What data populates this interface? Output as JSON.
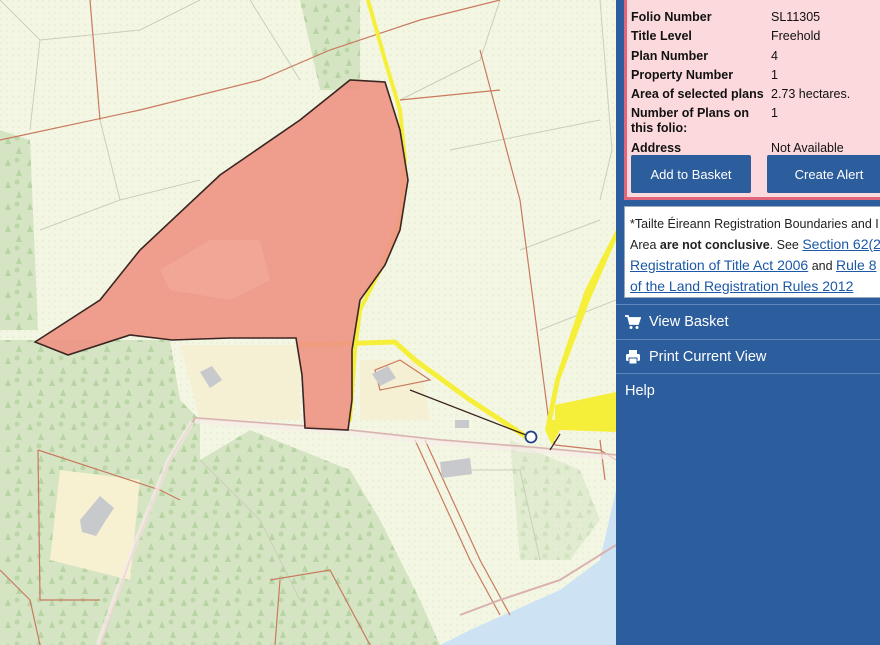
{
  "folio": {
    "rows": [
      {
        "label": "Folio Number",
        "value": "SL11305"
      },
      {
        "label": "Title Level",
        "value": "Freehold"
      },
      {
        "label": "Plan Number",
        "value": "4"
      },
      {
        "label": "Property Number",
        "value": "1"
      },
      {
        "label": "Area of selected plans",
        "value": "2.73 hectares."
      },
      {
        "label": "Number of Plans on this folio:",
        "value": "1"
      },
      {
        "label": "Address",
        "value": "Not Available"
      }
    ],
    "add_to_basket_label": "Add to Basket",
    "create_alert_label": "Create Alert"
  },
  "notice": {
    "line1": "*Tailte Éireann Registration Boundaries and I",
    "line2_pre": "Area ",
    "line2_bold": "are not conclusive",
    "line2_post": ". See ",
    "link1_a": "Section 62(2",
    "link1_b": "Registration of Title Act 2006",
    "and_text": " and ",
    "link2_a": "Rule 8",
    "link2_b": "of the Land Registration Rules 2012"
  },
  "menu": {
    "view_basket": "View Basket",
    "print_current_view": "Print Current View",
    "help": "Help"
  },
  "colors": {
    "panel_bg": "#2c5d9c",
    "folio_bg": "#fbd9dc",
    "folio_border": "#e2667b",
    "parcel_fill": "#ee9585",
    "road_highlight": "#f6ef3a",
    "forest": "#d6e6c4",
    "water": "#cfe5f5"
  },
  "icons": {
    "view_basket": "shopping-cart-icon",
    "print": "printer-icon",
    "location_marker": "circle-marker-icon"
  }
}
